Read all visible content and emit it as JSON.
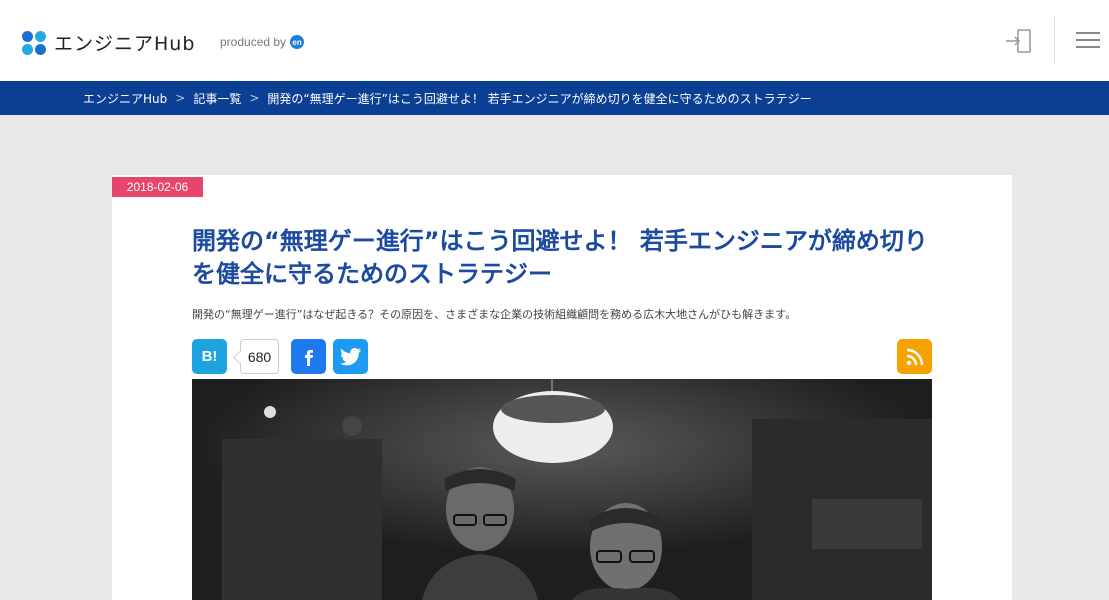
{
  "header": {
    "logo_text": "エンジニアHub",
    "produced_by": "produced by",
    "produced_badge": "en"
  },
  "breadcrumb": {
    "items": [
      "エンジニアHub",
      "記事一覧",
      "開発の“無理ゲー進行”はこう回避せよ！ 若手エンジニアが締め切りを健全に守るためのストラテジー"
    ],
    "separator": ">"
  },
  "article": {
    "date": "2018-02-06",
    "title": "開発の“無理ゲー進行”はこう回避せよ！ 若手エンジニアが締め切りを健全に守るためのストラテジー",
    "lead": "開発の“無理ゲー進行”はなぜ起きる？その原因を、さまざまな企業の技術組織顧問を務める広木大地さんがひも解きます。",
    "share": {
      "hatena_label": "B!",
      "hatena_count": "680"
    }
  },
  "colors": {
    "accent_blue": "#0b3f94",
    "title_blue": "#1b4aa0",
    "date_pink": "#e8456a",
    "hatena": "#1ca3e0",
    "facebook": "#1e78f0",
    "twitter": "#1d9bf0",
    "rss": "#f5a300"
  },
  "icons": [
    "logo-mark-icon",
    "login-icon",
    "menu-icon",
    "facebook-icon",
    "twitter-icon",
    "rss-icon"
  ]
}
